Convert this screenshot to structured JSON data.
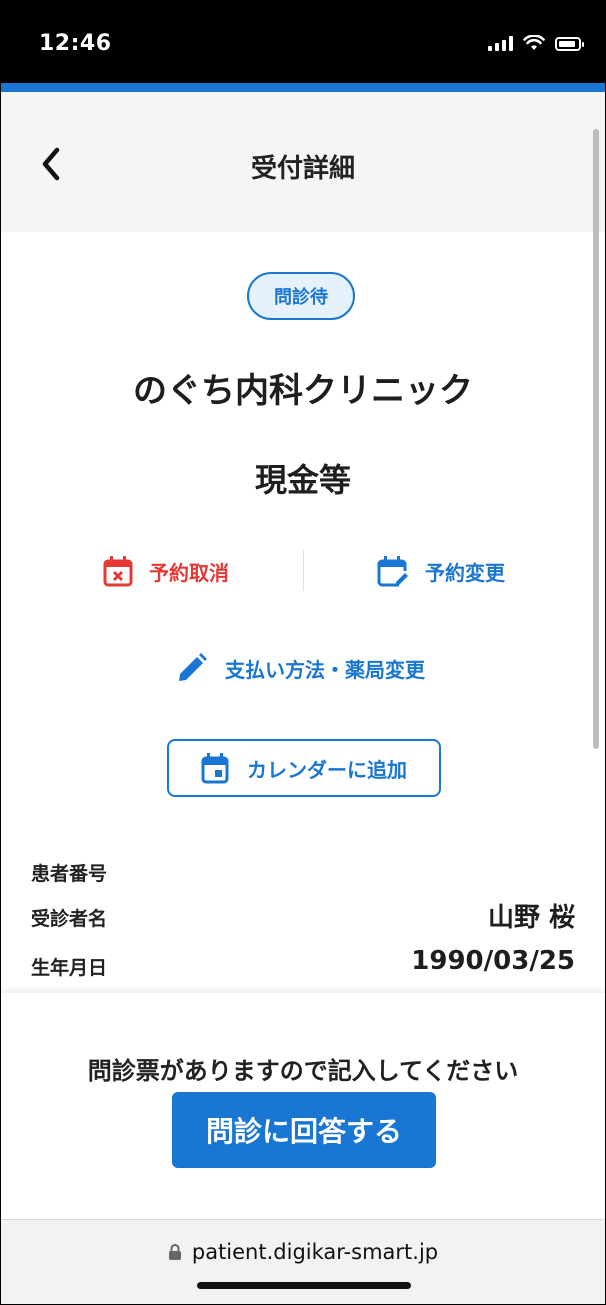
{
  "status_bar": {
    "time": "12:46"
  },
  "header": {
    "title": "受付詳細"
  },
  "reception": {
    "status_badge": "問診待",
    "clinic_name": "のぐち内科クリニック",
    "payment_method": "現金等"
  },
  "actions": {
    "cancel_label": "予約取消",
    "change_label": "予約変更",
    "change_payment_label": "支払い方法・薬局変更",
    "calendar_label": "カレンダーに追加"
  },
  "patient_info": {
    "patient_number_label": "患者番号",
    "patient_number_value": "",
    "patient_name_label": "受診者名",
    "patient_name_value": "山野 桜",
    "birthdate_label": "生年月日",
    "birthdate_value": "1990/03/25"
  },
  "footer": {
    "notice": "問診票がありますので記入してください",
    "answer_button": "問診に回答する"
  },
  "browser": {
    "url": "patient.digikar-smart.jp"
  },
  "colors": {
    "accent": "#1976d2",
    "danger": "#e53935",
    "header_bg": "#f5f5f5"
  }
}
